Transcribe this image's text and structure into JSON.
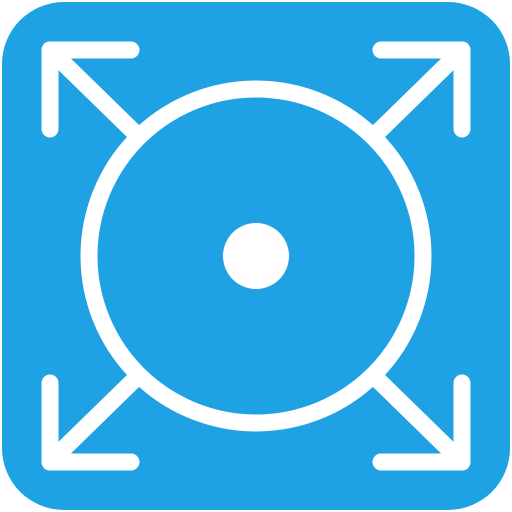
{
  "icon": {
    "name": "expand-circle-app-icon",
    "background_color": "#1ea2e3",
    "foreground_color": "#ffffff",
    "elements": [
      "expand-arrow-top-left-icon",
      "expand-arrow-top-right-icon",
      "expand-arrow-bottom-left-icon",
      "expand-arrow-bottom-right-icon",
      "circle-ring-icon",
      "center-dot-icon"
    ]
  }
}
